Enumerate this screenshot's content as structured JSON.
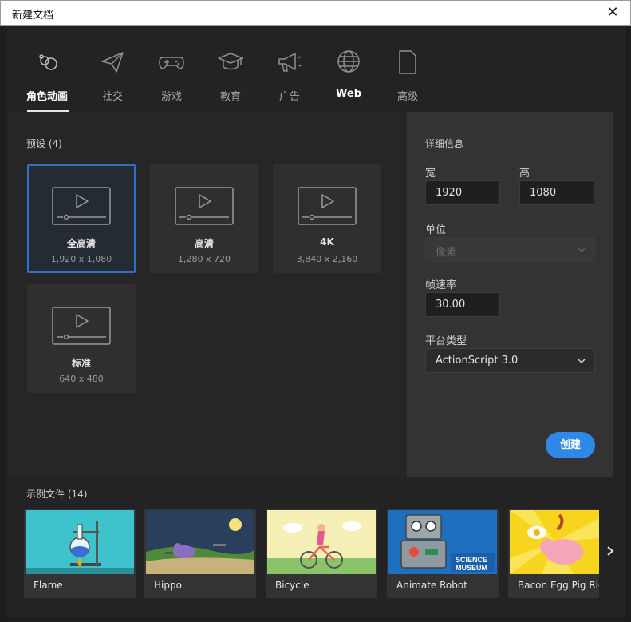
{
  "window": {
    "title": "新建文档"
  },
  "tabs": [
    {
      "label": "角色动画",
      "icon": "character-animation-icon"
    },
    {
      "label": "社交",
      "icon": "paper-plane-icon"
    },
    {
      "label": "游戏",
      "icon": "gamepad-icon"
    },
    {
      "label": "教育",
      "icon": "graduation-cap-icon"
    },
    {
      "label": "广告",
      "icon": "megaphone-icon"
    },
    {
      "label": "Web",
      "icon": "globe-icon"
    },
    {
      "label": "高级",
      "icon": "document-icon"
    }
  ],
  "presets": {
    "heading": "预设 (4)",
    "items": [
      {
        "name": "全高清",
        "dims": "1,920 x 1,080"
      },
      {
        "name": "高清",
        "dims": "1,280 x 720"
      },
      {
        "name": "4K",
        "dims": "3,840 x 2,160"
      },
      {
        "name": "标准",
        "dims": "640 x 480"
      }
    ]
  },
  "details": {
    "heading": "详细信息",
    "width_label": "宽",
    "width_value": "1920",
    "height_label": "高",
    "height_value": "1080",
    "unit_label": "单位",
    "unit_value": "像素",
    "fps_label": "帧速率",
    "fps_value": "30.00",
    "platform_label": "平台类型",
    "platform_value": "ActionScript 3.0",
    "create_label": "创建"
  },
  "samples": {
    "heading": "示例文件 (14)",
    "items": [
      {
        "name": "Flame"
      },
      {
        "name": "Hippo"
      },
      {
        "name": "Bicycle"
      },
      {
        "name": "Animate Robot"
      },
      {
        "name": "Bacon Egg Pig Rider"
      }
    ]
  },
  "colors": {
    "accent": "#2d88e8",
    "selected_border": "#2f6fc8",
    "background": "#232323",
    "panel": "#333333"
  }
}
